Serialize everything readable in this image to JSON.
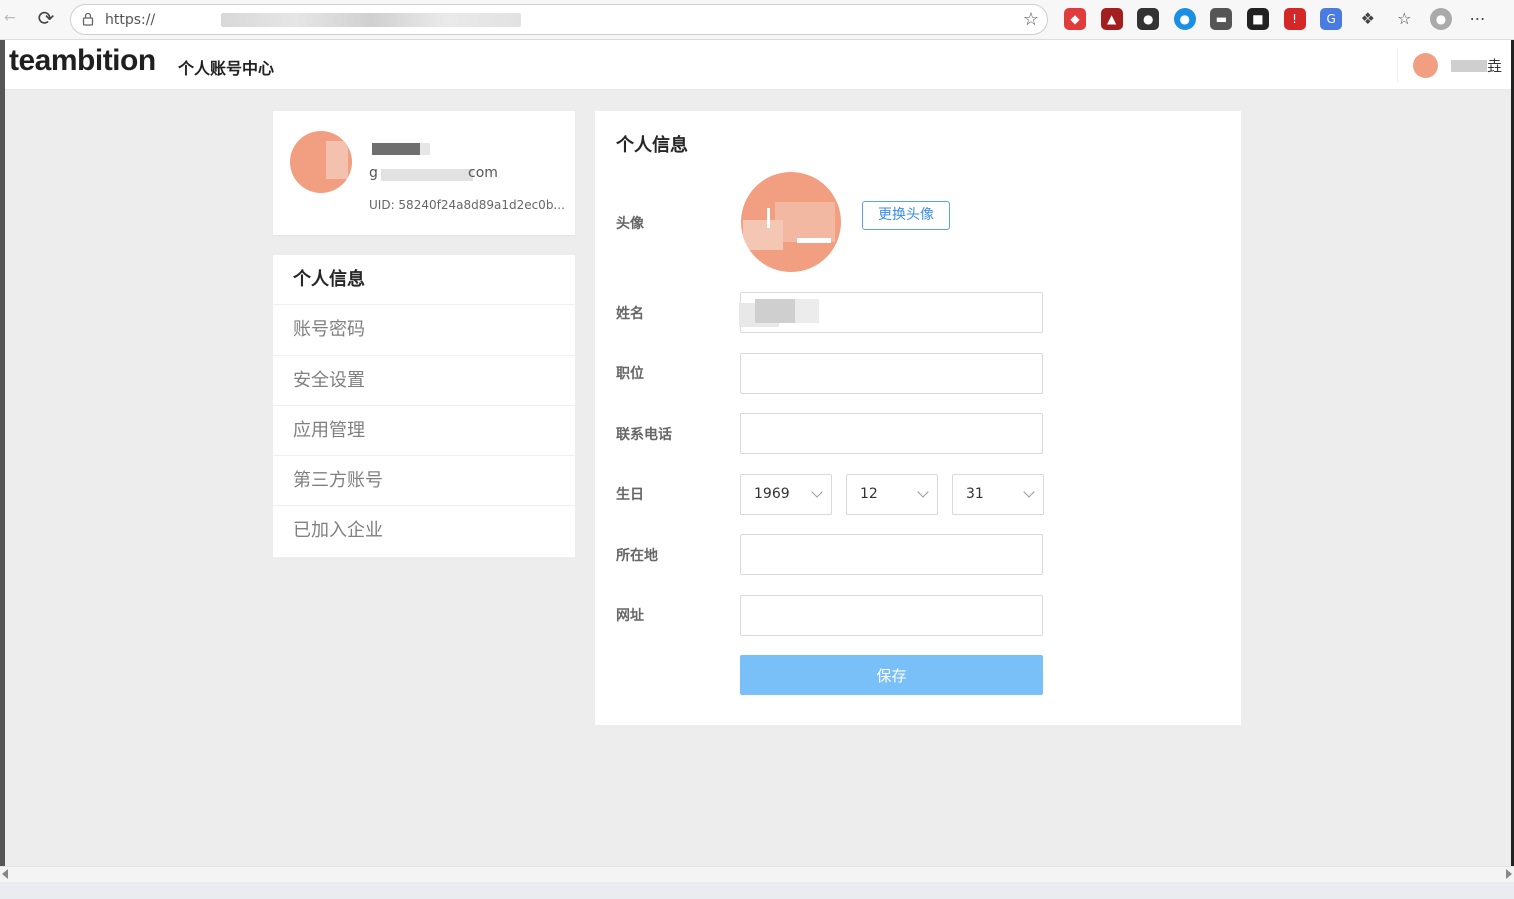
{
  "browser": {
    "url": "https://",
    "icons": [
      "back-icon",
      "reload-icon",
      "lock-icon",
      "star-icon",
      "extensions-icon",
      "favorites-icon",
      "profile-icon",
      "more-icon"
    ]
  },
  "app": {
    "logo": "teambition",
    "subtitle": "个人账号中心",
    "header_user_name": "垚"
  },
  "profile": {
    "email_prefix": "g",
    "email_suffix": "com",
    "uid": "UID: 58240f24a8d89a1d2ec0b..."
  },
  "menu": {
    "items": [
      {
        "label": "个人信息",
        "active": true
      },
      {
        "label": "账号密码",
        "active": false
      },
      {
        "label": "安全设置",
        "active": false
      },
      {
        "label": "应用管理",
        "active": false
      },
      {
        "label": "第三方账号",
        "active": false
      },
      {
        "label": "已加入企业",
        "active": false
      }
    ]
  },
  "form": {
    "title": "个人信息",
    "avatar_label": "头像",
    "change_avatar": "更换头像",
    "name_label": "姓名",
    "name_value": "",
    "position_label": "职位",
    "position_value": "",
    "phone_label": "联系电话",
    "phone_value": "",
    "birthday_label": "生日",
    "birthday": {
      "year": "1969",
      "month": "12",
      "day": "31"
    },
    "location_label": "所在地",
    "location_value": "",
    "website_label": "网址",
    "website_value": "",
    "save": "保存"
  },
  "colors": {
    "primary": "#3a8ee6",
    "save_button": "#78c0f7",
    "avatar": "#f19e81",
    "background": "#ededed"
  }
}
